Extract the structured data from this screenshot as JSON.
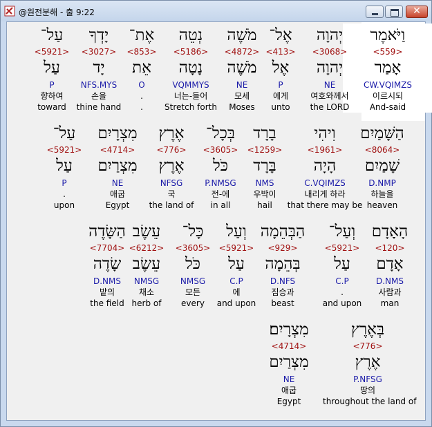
{
  "window": {
    "title": "@원전분해 - 출 9:22"
  },
  "rows": [
    [
      {
        "heb": "וַיֹּאמֶר",
        "strong": "<559>",
        "lemma": "אָמַר",
        "morph": "CW.VQIMZS",
        "kor": "이르시되",
        "eng": "And-said",
        "highlight": true
      },
      {
        "heb": "יְהוָה",
        "strong": "<3068>",
        "lemma": "יְהוָה",
        "morph": "NE",
        "kor": "여호와께서",
        "eng": "the LORD"
      },
      {
        "heb": "אֶל־",
        "strong": "<413>",
        "lemma": "אֶל",
        "morph": "P",
        "kor": "에게",
        "eng": "unto"
      },
      {
        "heb": "מֹשֶׁה",
        "strong": "<4872>",
        "lemma": "מֹשֶׁה",
        "morph": "NE",
        "kor": "모세",
        "eng": "Moses"
      },
      {
        "heb": "נְטֵה",
        "strong": "<5186>",
        "lemma": "נָטָה",
        "morph": "VQMMYS",
        "kor": "너는-들어",
        "eng": "Stretch forth"
      },
      {
        "heb": "אֶת־",
        "strong": "<853>",
        "lemma": "אֵת",
        "morph": "O",
        "kor": ".",
        "eng": "."
      },
      {
        "heb": "יָדְךָ",
        "strong": "<3027>",
        "lemma": "יָד",
        "morph": "NFS.MYS",
        "kor": "손을",
        "eng": "thine hand"
      },
      {
        "heb": "עַל־",
        "strong": "<5921>",
        "lemma": "עַל",
        "morph": "P",
        "kor": "향하여",
        "eng": "toward"
      }
    ],
    [
      {
        "heb": "הַשָּׁמַיִם",
        "strong": "<8064>",
        "lemma": "שָׁמַיִם",
        "morph": "D.NMP",
        "kor": "하늘을",
        "eng": "heaven"
      },
      {
        "heb": "וִיהִי",
        "strong": "<1961>",
        "lemma": "הָיָה",
        "morph": "C.VQIMZS",
        "kor": "내리게 하라",
        "eng": "that there may be"
      },
      {
        "heb": "בָרָד",
        "strong": "<1259>",
        "lemma": "בָּרָד",
        "morph": "NMS",
        "kor": "우박이",
        "eng": "hail"
      },
      {
        "heb": "בְּכָל־",
        "strong": "<3605>",
        "lemma": "כֹּל",
        "morph": "P.NMSG",
        "kor": "전-에",
        "eng": "in all"
      },
      {
        "heb": "אֶרֶץ",
        "strong": "<776>",
        "lemma": "אֶרֶץ",
        "morph": "NFSG",
        "kor": "국",
        "eng": "the land of"
      },
      {
        "heb": "מִצְרָיִם",
        "strong": "<4714>",
        "lemma": "מִצְרַיִם",
        "morph": "NE",
        "kor": "애굽",
        "eng": "Egypt"
      },
      {
        "heb": "עַל־",
        "strong": "<5921>",
        "lemma": "עַל",
        "morph": "P",
        "kor": ".",
        "eng": "upon"
      }
    ],
    [
      {
        "heb": "הָאָדָם",
        "strong": "<120>",
        "lemma": "אָדָם",
        "morph": "D.NMS",
        "kor": "사람과",
        "eng": "man"
      },
      {
        "heb": "וְעַל־",
        "strong": "<5921>",
        "lemma": "עַל",
        "morph": "C.P",
        "kor": ".",
        "eng": "and upon"
      },
      {
        "heb": "הַבְּהֵמָה",
        "strong": "<929>",
        "lemma": "בְּהֵמָה",
        "morph": "D.NFS",
        "kor": "짐승과",
        "eng": "beast"
      },
      {
        "heb": "וְעַל",
        "strong": "<5921>",
        "lemma": "עַל",
        "morph": "C.P",
        "kor": "에",
        "eng": "and upon"
      },
      {
        "heb": "כָּל־",
        "strong": "<3605>",
        "lemma": "כֹּל",
        "morph": "NMSG",
        "kor": "모든",
        "eng": "every"
      },
      {
        "heb": "עֵשֶׂב",
        "strong": "<6212>",
        "lemma": "עֵשֶׂב",
        "morph": "NMSG",
        "kor": "채소",
        "eng": "herb of"
      },
      {
        "heb": "הַשָּׂדֶה",
        "strong": "<7704>",
        "lemma": "שָׂדֶה",
        "morph": "D.NMS",
        "kor": "밭의",
        "eng": "the field"
      }
    ],
    [
      {
        "heb": "בְּאֶרֶץ",
        "strong": "<776>",
        "lemma": "אֶרֶץ",
        "morph": "P.NFSG",
        "kor": "땅의",
        "eng": "throughout the land of"
      },
      {
        "heb": "מִצְרָיִם׃",
        "strong": "<4714>",
        "lemma": "מִצְרַיִם",
        "morph": "NE",
        "kor": "애굽",
        "eng": "Egypt"
      }
    ]
  ]
}
